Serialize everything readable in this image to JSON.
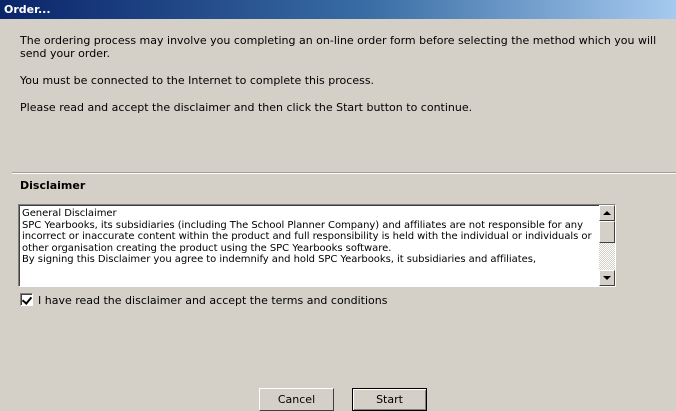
{
  "window": {
    "title": "Order..."
  },
  "intro": {
    "paragraph1": "The ordering process may involve you completing an on-line order form before selecting the method which you will send your order.",
    "paragraph2": "You must be connected to the Internet to complete this process.",
    "paragraph3": "Please read and accept the disclaimer and then click the Start button to continue."
  },
  "disclaimer": {
    "heading": "Disclaimer",
    "text": "General Disclaimer\nSPC Yearbooks, its subsidiaries (including The School Planner Company) and affiliates are not responsible for any incorrect or inaccurate content within the product and full responsibility is held with the individual or individuals or other organisation creating the product using the SPC Yearbooks software.\nBy signing this Disclaimer you agree to indemnify and hold SPC Yearbooks, it subsidiaries and affiliates,",
    "checkbox_label": "I have read the disclaimer and accept the terms and conditions",
    "checkbox_checked": true
  },
  "buttons": {
    "cancel": "Cancel",
    "start": "Start"
  }
}
